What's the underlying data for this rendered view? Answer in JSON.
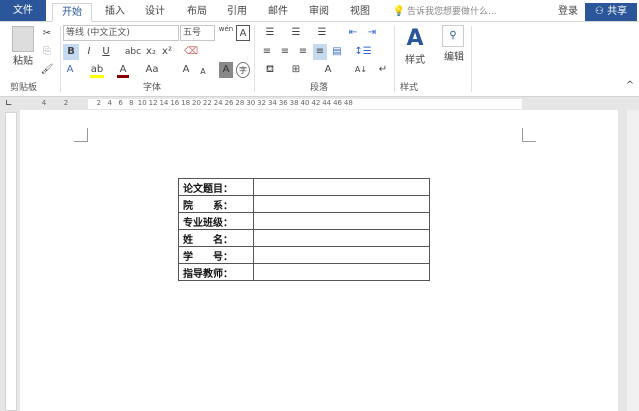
{
  "tabs": {
    "file": "文件",
    "items": [
      "开始",
      "插入",
      "设计",
      "布局",
      "引用",
      "邮件",
      "审阅",
      "视图"
    ],
    "tell_me": "告诉我您想要做什么...",
    "login": "登录",
    "share": "共享"
  },
  "ribbon": {
    "clipboard": {
      "paste": "粘贴",
      "label": "剪贴板"
    },
    "font": {
      "font_name": "等线 (中文正文)",
      "font_size": "五号",
      "bold": "B",
      "italic": "I",
      "underline": "U",
      "strike": "abc",
      "sub": "x₂",
      "sup": "x²",
      "aa": "Aa",
      "grow": "A",
      "shrink": "A",
      "label": "字体",
      "phonetic": "wén",
      "border_char": "A",
      "enclose": "字"
    },
    "paragraph": {
      "label": "段落"
    },
    "styles": {
      "styles_btn": "样式",
      "label": "样式"
    },
    "editing": {
      "label": "编辑"
    }
  },
  "ruler": {
    "left": [
      "4",
      "2"
    ],
    "marks": [
      "2",
      "4",
      "6",
      "8",
      "10",
      "12",
      "14",
      "16",
      "18",
      "20",
      "22",
      "24",
      "26",
      "28",
      "30",
      "32",
      "34",
      "36",
      "38",
      "40",
      "42",
      "44",
      "46",
      "48"
    ]
  },
  "table": {
    "rows": [
      [
        "论文题目：",
        ""
      ],
      [
        "院　　系：",
        ""
      ],
      [
        "专业班级：",
        ""
      ],
      [
        "姓　　名：",
        ""
      ],
      [
        "学　　号：",
        ""
      ],
      [
        "指导教师：",
        ""
      ]
    ]
  }
}
